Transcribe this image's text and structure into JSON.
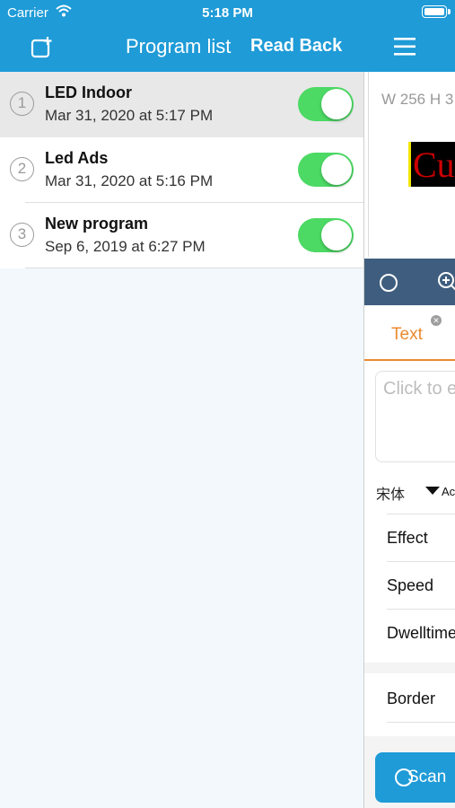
{
  "status_bar": {
    "carrier": "Carrier",
    "time": "5:18 PM"
  },
  "nav_bar": {
    "title": "Program list",
    "read_back": "Read Back",
    "add_icon": "add-program-icon",
    "menu_icon": "hamburger-menu-icon"
  },
  "programs": [
    {
      "index": "1",
      "name": "LED Indoor",
      "date": "Mar 31, 2020 at 5:17 PM",
      "enabled": true,
      "selected": true
    },
    {
      "index": "2",
      "name": "Led Ads",
      "date": "Mar 31, 2020 at 5:16 PM",
      "enabled": true,
      "selected": false
    },
    {
      "index": "3",
      "name": "New program",
      "date": "Sep 6, 2019 at 6:27 PM",
      "enabled": true,
      "selected": false
    }
  ],
  "editor": {
    "canvas_size": "W 256 H 3",
    "preview_text": "Cu",
    "tab_label": "Text",
    "text_placeholder": "Click to e",
    "font_name": "宋体",
    "font_option_partial": "Ac",
    "settings": [
      "Effect",
      "Speed",
      "Dwelltime"
    ],
    "border_label": "Border",
    "scan_label": "Scan"
  },
  "colors": {
    "nav_blue": "#1f9bd7",
    "toggle_on": "#4cd964",
    "tab_orange": "#ea8a2f",
    "tool_strip": "#3f5e7f"
  }
}
